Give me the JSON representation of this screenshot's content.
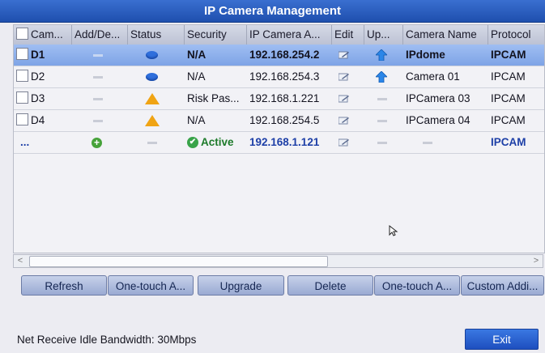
{
  "window": {
    "title": "IP Camera Management"
  },
  "table": {
    "headers": [
      "Cam...",
      "Add/De...",
      "Status",
      "Security",
      "IP Camera A...",
      "Edit",
      "Up...",
      "Camera Name",
      "Protocol"
    ],
    "rows": [
      {
        "cam": "D1",
        "security": "N/A",
        "ip": "192.168.254.2",
        "name": "IPdome",
        "protocol": "IPCAM"
      },
      {
        "cam": "D2",
        "security": "N/A",
        "ip": "192.168.254.3",
        "name": "Camera 01",
        "protocol": "IPCAM"
      },
      {
        "cam": "D3",
        "security": "Risk Pas...",
        "ip": "192.168.1.221",
        "name": "IPCamera 03",
        "protocol": "IPCAM"
      },
      {
        "cam": "D4",
        "security": "N/A",
        "ip": "192.168.254.5",
        "name": "IPCamera 04",
        "protocol": "IPCAM"
      },
      {
        "cam": "...",
        "security": "Active",
        "ip": "192.168.1.121",
        "name": "",
        "protocol": "IPCAM"
      }
    ]
  },
  "buttons": {
    "refresh": "Refresh",
    "one_touch_1": "One-touch A...",
    "upgrade": "Upgrade",
    "delete": "Delete",
    "one_touch_2": "One-touch A...",
    "custom_add": "Custom Addi..."
  },
  "footer": {
    "bandwidth": "Net Receive Idle Bandwidth: 30Mbps",
    "exit": "Exit"
  },
  "colors": {
    "titlebar": "#1f4fae",
    "selected_row": "#7ea4e6",
    "accent_blue": "#1d3fa7",
    "active_green": "#1d7a2a",
    "warning": "#f0a414"
  }
}
